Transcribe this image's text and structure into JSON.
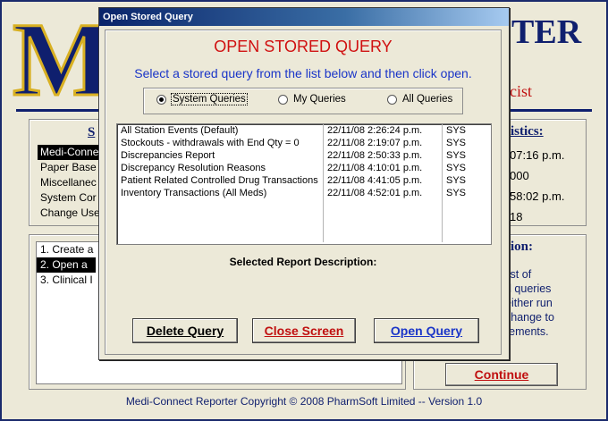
{
  "background": {
    "logo_letter": "M",
    "title_fragment": "TER",
    "subtitle_fragment": "cist",
    "left_panel_heading": "S",
    "menu_items": [
      "Medi-Connect",
      "Paper Base",
      "Miscellanec",
      "System Cor",
      "Change Use"
    ],
    "list_items": [
      "1.  Create a",
      "2.  Open a",
      "3.  Clinical I"
    ],
    "stats_heading": "tistics:",
    "stats_values": [
      "07:16 p.m.",
      "000",
      "58:02 p.m.",
      "18"
    ],
    "desc_heading": "tion:",
    "desc_lines": [
      "list of",
      "d queries",
      "either run",
      "change to",
      "rements."
    ],
    "continue_label": "Continue",
    "footer": "Medi-Connect Reporter Copyright © 2008 PharmSoft Limited  -- Version 1.0"
  },
  "dialog": {
    "window_title": "Open Stored Query",
    "heading": "OPEN STORED QUERY",
    "instruction": "Select a stored query from the list below and then click open.",
    "radios": [
      {
        "label": "System Queries",
        "selected": true
      },
      {
        "label": "My Queries",
        "selected": false
      },
      {
        "label": "All Queries",
        "selected": false
      }
    ],
    "queries": [
      {
        "name": "All Station Events (Default)",
        "date": "22/11/08 2:26:24 p.m.",
        "owner": "SYS"
      },
      {
        "name": "Stockouts - withdrawals with End Qty = 0",
        "date": "22/11/08 2:19:07 p.m.",
        "owner": "SYS"
      },
      {
        "name": "Discrepancies Report",
        "date": "22/11/08 2:50:33 p.m.",
        "owner": "SYS"
      },
      {
        "name": "Discrepancy Resolution Reasons",
        "date": "22/11/08 4:10:01 p.m.",
        "owner": "SYS"
      },
      {
        "name": "Patient Related Controlled Drug Transactions",
        "date": "22/11/08 4:41:05 p.m.",
        "owner": "SYS"
      },
      {
        "name": "Inventory Transactions (All Meds)",
        "date": "22/11/08 4:52:01 p.m.",
        "owner": "SYS"
      }
    ],
    "selected_desc_label": "Selected Report Description:",
    "buttons": {
      "delete": "Delete Query",
      "close": "Close Screen",
      "open": "Open Query"
    }
  },
  "colors": {
    "navy": "#0f1f6e",
    "gold": "#d8b022",
    "red": "#d01010",
    "blue": "#1a35c8",
    "face": "#ece9d8"
  }
}
